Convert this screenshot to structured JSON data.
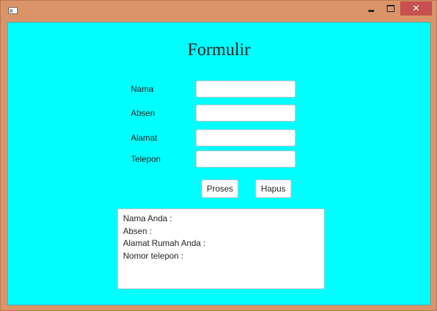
{
  "window": {
    "close_symbol": "✕"
  },
  "form": {
    "title": "Formulir",
    "fields": [
      {
        "label": "Nama",
        "value": "",
        "placeholder": ""
      },
      {
        "label": "Absen",
        "value": "",
        "placeholder": ""
      },
      {
        "label": "Alamat",
        "value": "",
        "placeholder": ""
      },
      {
        "label": "Telepon",
        "value": "",
        "placeholder": ""
      }
    ],
    "buttons": {
      "proses": "Proses",
      "hapus": "Hapus"
    },
    "output_lines": [
      "Nama Anda :",
      "Absen :",
      "Alamat Rumah Anda :",
      "Nomor telepon :"
    ]
  },
  "colors": {
    "background": "#00ffff",
    "frame": "#db9468",
    "close_button": "#c75050"
  },
  "icons": {
    "app": "window-app-icon",
    "minimize": "minimize-icon",
    "maximize": "maximize-icon",
    "close": "close-icon"
  }
}
